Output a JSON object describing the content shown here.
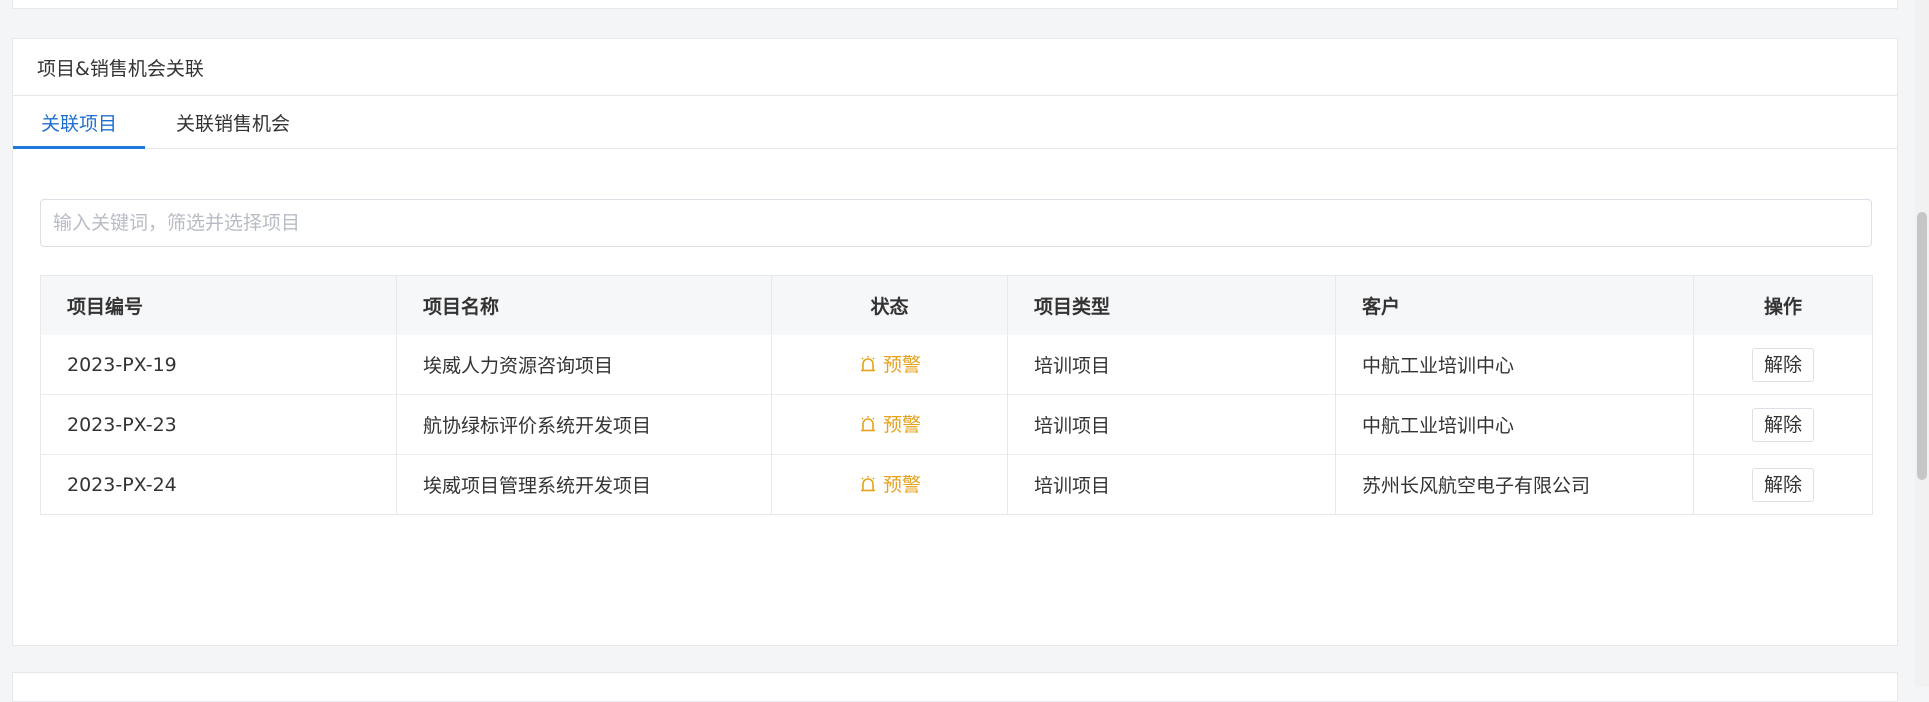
{
  "card": {
    "title": "项目&销售机会关联"
  },
  "tabs": [
    {
      "label": "关联项目",
      "active": true
    },
    {
      "label": "关联销售机会",
      "active": false
    }
  ],
  "search": {
    "placeholder": "输入关键词，筛选并选择项目",
    "value": ""
  },
  "table": {
    "columns": [
      "项目编号",
      "项目名称",
      "状态",
      "项目类型",
      "客户",
      "操作"
    ],
    "rows": [
      {
        "code": "2023-PX-19",
        "name": "埃威人力资源咨询项目",
        "status": "预警",
        "type": "培训项目",
        "customer": "中航工业培训中心",
        "action": "解除"
      },
      {
        "code": "2023-PX-23",
        "name": "航协绿标评价系统开发项目",
        "status": "预警",
        "type": "培训项目",
        "customer": "中航工业培训中心",
        "action": "解除"
      },
      {
        "code": "2023-PX-24",
        "name": "埃威项目管理系统开发项目",
        "status": "预警",
        "type": "培训项目",
        "customer": "苏州长风航空电子有限公司",
        "action": "解除"
      }
    ]
  },
  "colors": {
    "accent": "#1f7ae0",
    "warning": "#e6a21d",
    "border": "#e6e8eb",
    "header_bg": "#f6f7f9",
    "page_bg": "#f4f5f7"
  },
  "icons": {
    "status": "alarm-icon"
  }
}
